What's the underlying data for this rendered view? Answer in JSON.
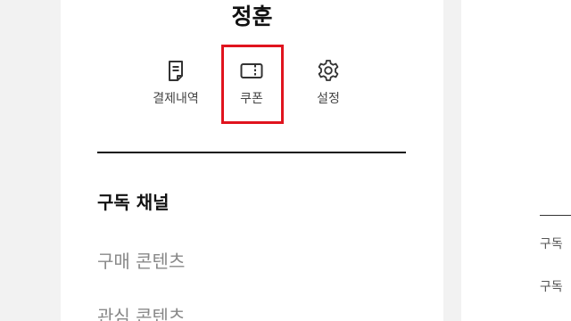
{
  "profile": {
    "name": "정훈"
  },
  "actions": [
    {
      "label": "결제내역",
      "icon": "receipt-icon"
    },
    {
      "label": "쿠폰",
      "icon": "ticket-icon"
    },
    {
      "label": "설정",
      "icon": "gear-icon"
    }
  ],
  "menu": {
    "items": [
      {
        "label": "구독 채널"
      },
      {
        "label": "구매 콘텐츠"
      },
      {
        "label": "관심 콘텐츠"
      }
    ]
  },
  "right": {
    "items": [
      {
        "label": "구독"
      },
      {
        "label": "구독"
      }
    ]
  },
  "colors": {
    "highlight": "#e0141e",
    "text": "#111111",
    "muted": "#888888"
  }
}
